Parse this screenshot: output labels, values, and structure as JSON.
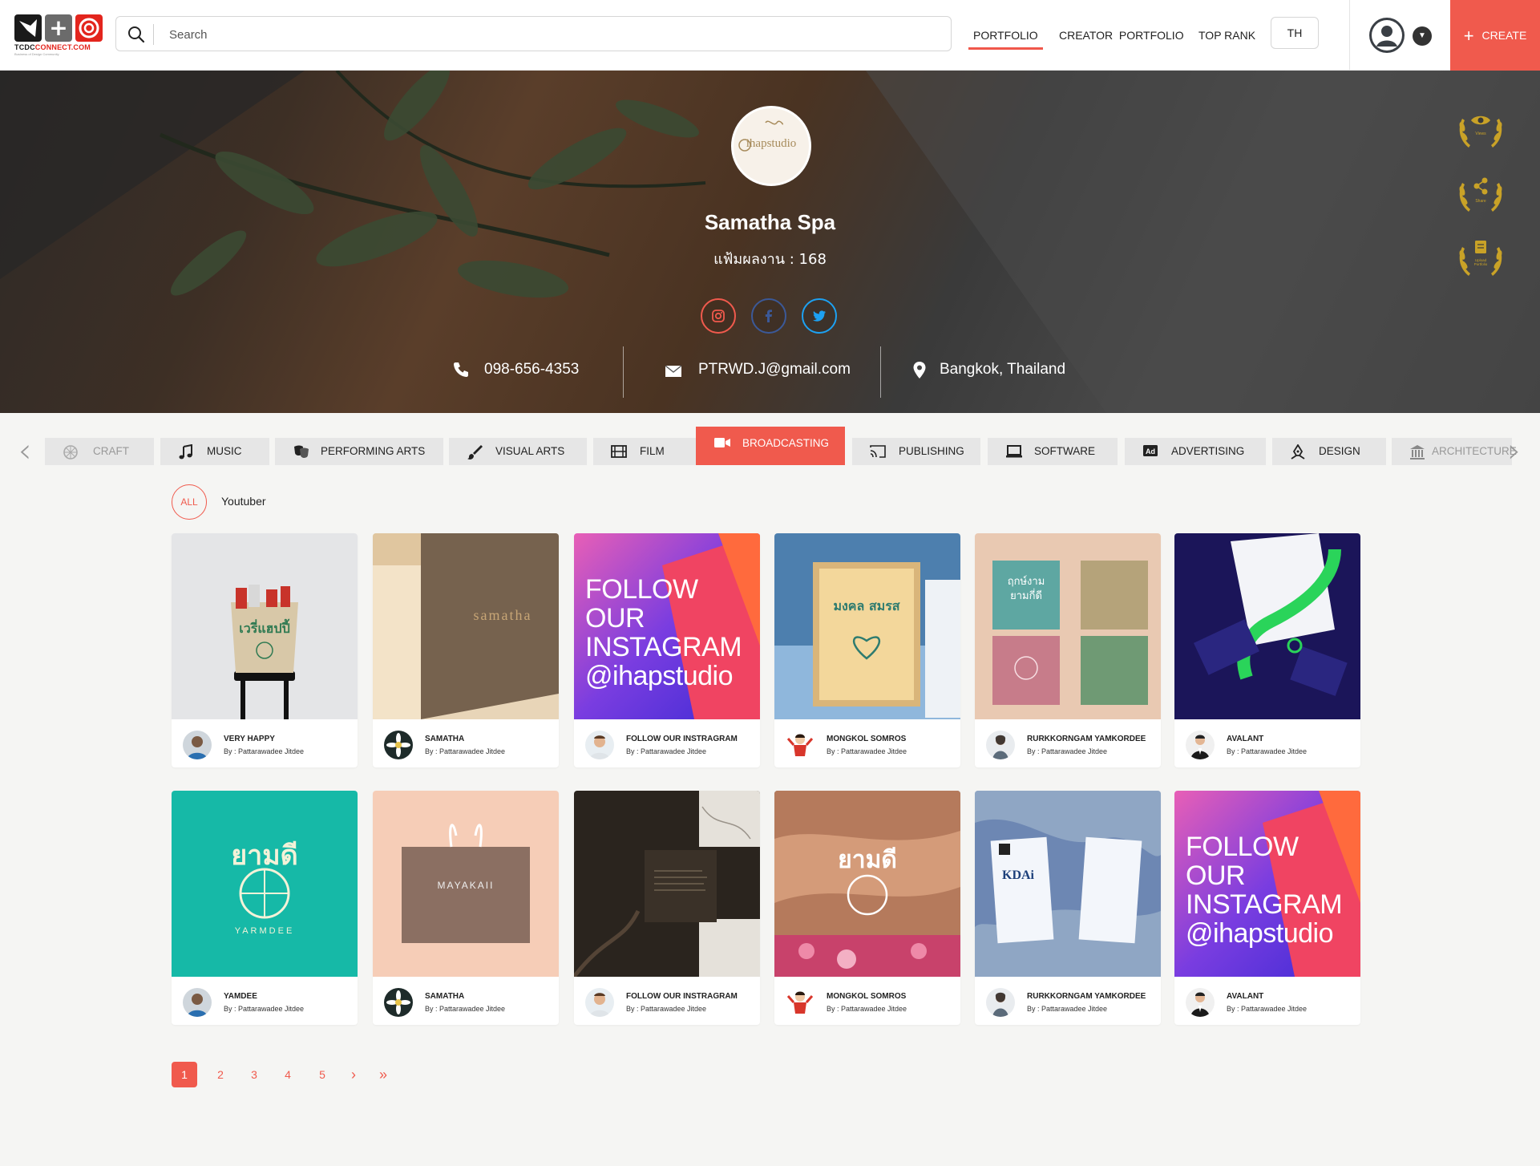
{
  "header": {
    "logo_text": "TCDCCONNECT.COM",
    "logo_tagline": "Business of Design Community",
    "search_placeholder": "Search",
    "nav": [
      "PORTFOLIO",
      "CREATOR  PORTFOLIO",
      "TOP RANK"
    ],
    "active_nav": "PORTFOLIO",
    "lang": "TH",
    "create_label": "CREATE"
  },
  "profile": {
    "avatar_text": "ihapstudio",
    "name": "Samatha Spa",
    "portfolio_count": "แฟ้มผลงาน : 168",
    "phone": "098-656-4353",
    "email": "PTRWD.J@gmail.com",
    "location": "Bangkok, Thailand",
    "social": [
      "instagram-icon",
      "facebook-icon",
      "twitter-icon"
    ],
    "awards": [
      {
        "icon": "eye-icon",
        "label": "Views"
      },
      {
        "icon": "share-icon",
        "label": "Share"
      },
      {
        "icon": "book-icon",
        "label": "Upload Portfolio"
      }
    ]
  },
  "categories": [
    {
      "label": "CRAFT",
      "icon": "craft-icon"
    },
    {
      "label": "MUSIC",
      "icon": "music-icon"
    },
    {
      "label": "PERFORMING ARTS",
      "icon": "masks-icon"
    },
    {
      "label": "VISUAL ARTS",
      "icon": "brush-icon"
    },
    {
      "label": "FILM",
      "icon": "film-icon"
    },
    {
      "label": "BROADCASTING",
      "icon": "camera-icon"
    },
    {
      "label": "PUBLISHING",
      "icon": "cast-icon"
    },
    {
      "label": "SOFTWARE",
      "icon": "laptop-icon"
    },
    {
      "label": "ADVERTISING",
      "icon": "ad-icon"
    },
    {
      "label": "DESIGN",
      "icon": "pen-tool-icon"
    },
    {
      "label": "ARCHITECTURE",
      "icon": "building-icon"
    }
  ],
  "active_category": "BROADCASTING",
  "filter": {
    "all_label": "ALL",
    "sub_label": "Youtuber"
  },
  "cards": [
    {
      "title": "VERY HAPPY",
      "author": "By : Pattarawadee Jitdee"
    },
    {
      "title": "SAMATHA",
      "author": "By : Pattarawadee Jitdee",
      "thumb_text": "samatha"
    },
    {
      "title": "FOLLOW OUR INSTRAGRAM",
      "author": "By : Pattarawadee Jitdee",
      "thumb_text": "FOLLOW OUR INSTAGRAM @ihapstudio"
    },
    {
      "title": "MONGKOL SOMROS",
      "author": "By : Pattarawadee Jitdee",
      "thumb_text": "มงคล สมรส"
    },
    {
      "title": "RURKKORNGAM YAMKORDEE",
      "author": "By : Pattarawadee Jitdee",
      "thumb_text": "ฤกษ์งาม ยามกี่ดี"
    },
    {
      "title": "AVALANT",
      "author": "By : Pattarawadee Jitdee"
    },
    {
      "title": "YAMDEE",
      "author": "By : Pattarawadee Jitdee",
      "thumb_text": "ยามดี"
    },
    {
      "title": "SAMATHA",
      "author": "By : Pattarawadee Jitdee",
      "thumb_text": "MAYAKAII"
    },
    {
      "title": "FOLLOW OUR INSTRAGRAM",
      "author": "By : Pattarawadee Jitdee"
    },
    {
      "title": "MONGKOL SOMROS",
      "author": "By : Pattarawadee Jitdee",
      "thumb_text": "ยามดี"
    },
    {
      "title": "RURKKORNGAM YAMKORDEE",
      "author": "By : Pattarawadee Jitdee",
      "thumb_text": "KDAi"
    },
    {
      "title": "AVALANT",
      "author": "By : Pattarawadee Jitdee",
      "thumb_text": "FOLLOW OUR INSTAGRAM @ihapstudio"
    }
  ],
  "pagination": {
    "pages": [
      "1",
      "2",
      "3",
      "4",
      "5"
    ],
    "current": "1",
    "next": "›",
    "last": "»"
  },
  "colors": {
    "accent": "#f05a4d",
    "background": "#f5f5f3",
    "award_gold": "#c9a227"
  }
}
